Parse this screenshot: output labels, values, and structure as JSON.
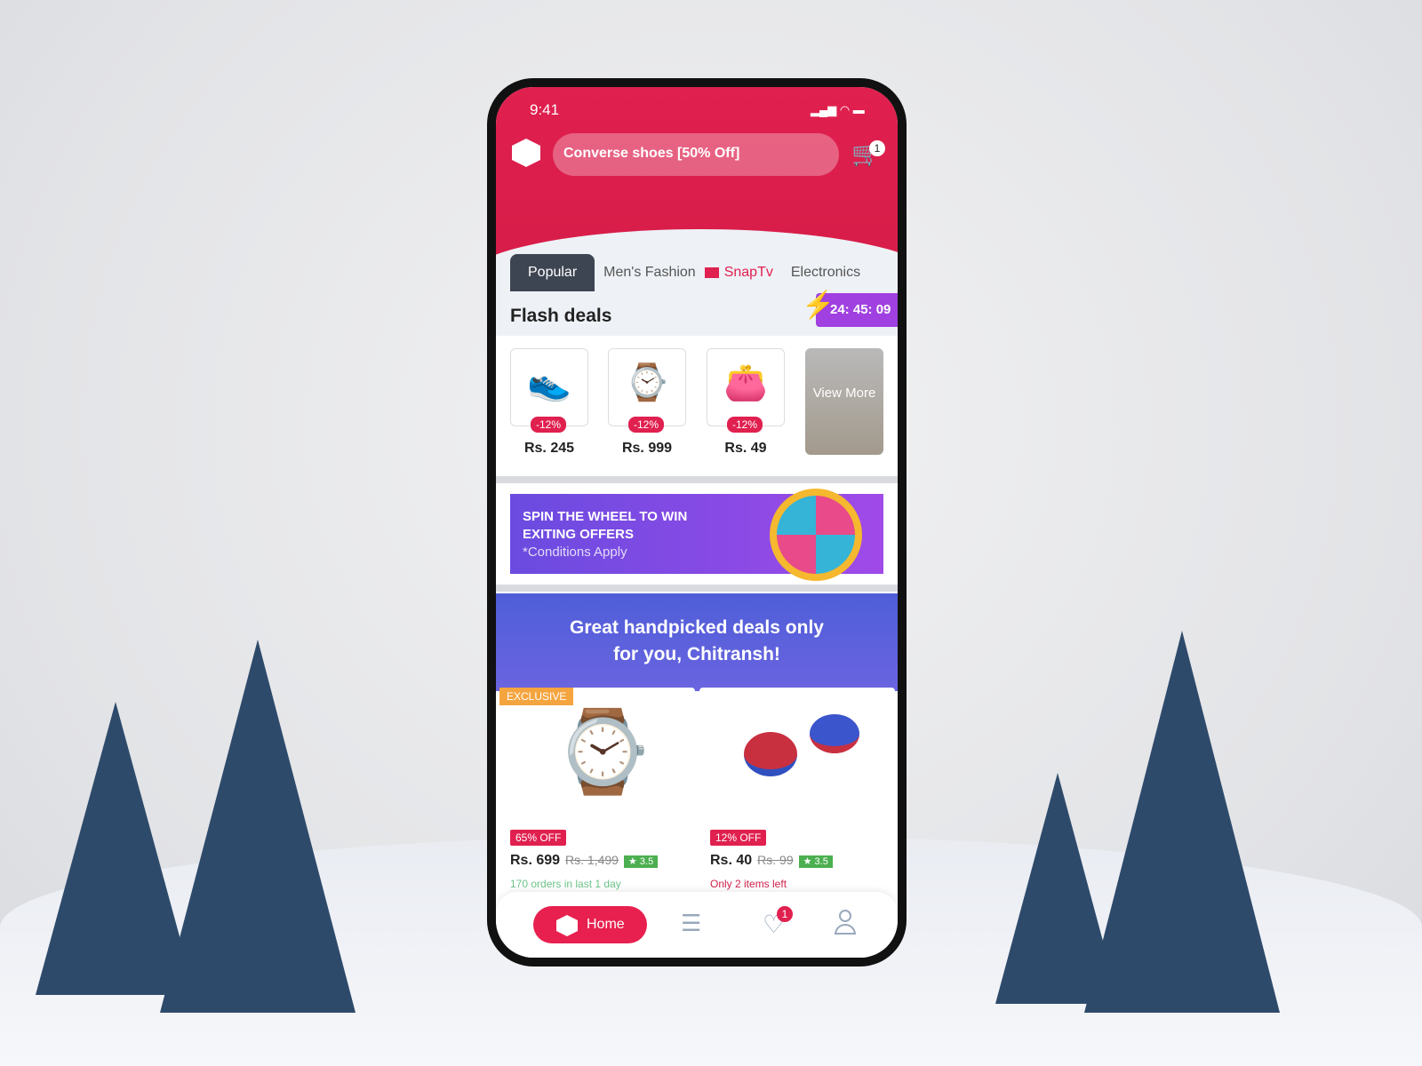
{
  "status": {
    "time": "9:41"
  },
  "header": {
    "search_value": "Converse shoes [50% Off]",
    "cart_count": "1"
  },
  "tabs": [
    {
      "label": "Popular"
    },
    {
      "label": "Men's Fashion"
    },
    {
      "label": "SnapTv"
    },
    {
      "label": "Electronics"
    }
  ],
  "flash": {
    "title": "Flash deals",
    "timer": "24: 45: 09",
    "items": [
      {
        "discount": "-12%",
        "price": "Rs. 245",
        "icon": "sneaker"
      },
      {
        "discount": "-12%",
        "price": "Rs. 999",
        "icon": "watch"
      },
      {
        "discount": "-12%",
        "price": "Rs. 49",
        "icon": "handbag"
      }
    ],
    "view_more": "View More"
  },
  "spin": {
    "line1": "SPIN THE WHEEL TO WIN",
    "line2": "EXITING OFFERS",
    "note": "*Conditions Apply"
  },
  "handpicked": {
    "line1": "Great handpicked deals only",
    "line2": "for you, Chitransh!"
  },
  "products": [
    {
      "badge": "EXCLUSIVE",
      "off": "65% OFF",
      "price": "Rs. 699",
      "old": "Rs. 1,499",
      "rating": "3.5",
      "note": "170 orders in last 1 day",
      "note_color": "#6cc48a"
    },
    {
      "off": "12% OFF",
      "price": "Rs. 40",
      "old": "Rs. 99",
      "rating": "3.5",
      "note": "Only 2 items left",
      "note_color": "#d0204a"
    }
  ],
  "nav": {
    "home": "Home",
    "wishlist_count": "1"
  },
  "colors": {
    "brand": "#e0204f",
    "timer": "#a040e0",
    "rating": "#4caf50"
  }
}
